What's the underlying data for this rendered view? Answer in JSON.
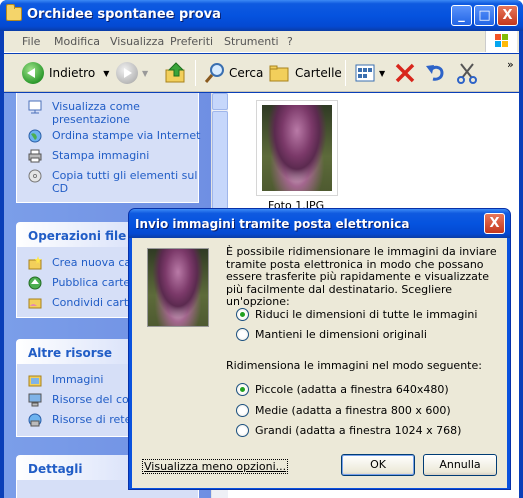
{
  "window": {
    "title": "Orchidee spontanee prova",
    "controls": [
      "_",
      "□",
      "X"
    ]
  },
  "menubar": {
    "items": [
      "File",
      "Modifica",
      "Visualizza",
      "Preferiti",
      "Strumenti",
      "?"
    ]
  },
  "toolbar": {
    "back_label": "Indietro",
    "search_label": "Cerca",
    "folders_label": "Cartelle",
    "more": "»"
  },
  "sidebar": {
    "picture_tasks": [
      {
        "label": "Visualizza come presentazione",
        "icon": "slideshow-icon"
      },
      {
        "label": "Ordina stampe via Internet",
        "icon": "globe-icon"
      },
      {
        "label": "Stampa immagini",
        "icon": "printer-icon"
      },
      {
        "label": "Copia tutti gli elementi sul CD",
        "icon": "cd-icon"
      }
    ],
    "file_ops": {
      "title": "Operazioni file e c",
      "items": [
        {
          "label": "Crea nuova car",
          "icon": "new-folder-icon"
        },
        {
          "label": "Pubblica cartella",
          "icon": "publish-icon"
        },
        {
          "label": "Condividi cartel",
          "icon": "share-folder-icon"
        }
      ]
    },
    "other_places": {
      "title": "Altre risorse",
      "items": [
        {
          "label": "Immagini",
          "icon": "pictures-folder-icon"
        },
        {
          "label": "Risorse del comp",
          "icon": "my-computer-icon"
        },
        {
          "label": "Risorse di rete",
          "icon": "network-icon"
        }
      ]
    },
    "details": {
      "title": "Dettagli"
    }
  },
  "file": {
    "name": "Foto 1.JPG"
  },
  "dialog": {
    "title": "Invio immagini tramite posta elettronica",
    "close": "X",
    "description": "È possibile ridimensionare le immagini da inviare tramite posta elettronica in modo che possano essere trasferite più rapidamente e visualizzate più facilmente dal destinatario. Scegliere un'opzione:",
    "options": [
      {
        "label": "Riduci le dimensioni di tutte le immagini",
        "selected": true
      },
      {
        "label": "Mantieni le dimensioni originali",
        "selected": false
      }
    ],
    "resize_label": "Ridimensiona le immagini nel modo seguente:",
    "sizes": [
      {
        "label": "Piccole (adatta a finestra 640x480)",
        "selected": true
      },
      {
        "label": "Medie (adatta a finestra 800 x 600)",
        "selected": false
      },
      {
        "label": "Grandi (adatta a finestra 1024 x 768)",
        "selected": false
      }
    ],
    "less_options_link": "Visualizza meno opzioni...",
    "ok_label": "OK",
    "cancel_label": "Annulla"
  }
}
